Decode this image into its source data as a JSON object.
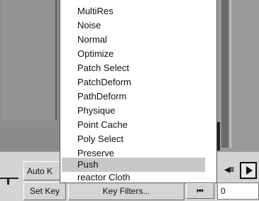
{
  "modifier_list": {
    "items": [
      "MultiRes",
      "Noise",
      "Normal",
      "Optimize",
      "Patch Select",
      "PatchDeform",
      "PathDeform",
      "Physique",
      "Point Cache",
      "Poly Select",
      "Preserve",
      "Push",
      "reactor Cloth"
    ],
    "selected": "Push"
  },
  "controls": {
    "auto_key": "Auto K",
    "set_key": "Set Key",
    "key_filters": "Key Filters...",
    "frame_value": "0",
    "goto_end_glyph": "⏮",
    "prev_frame_glyph": "◀II"
  },
  "icons": {
    "play": "play-icon",
    "scroll_down": "chevron-down-icon"
  },
  "colors": {
    "panel": "#d4d4d4",
    "list_bg": "#ffffff",
    "selection": "#c8c8c8"
  }
}
